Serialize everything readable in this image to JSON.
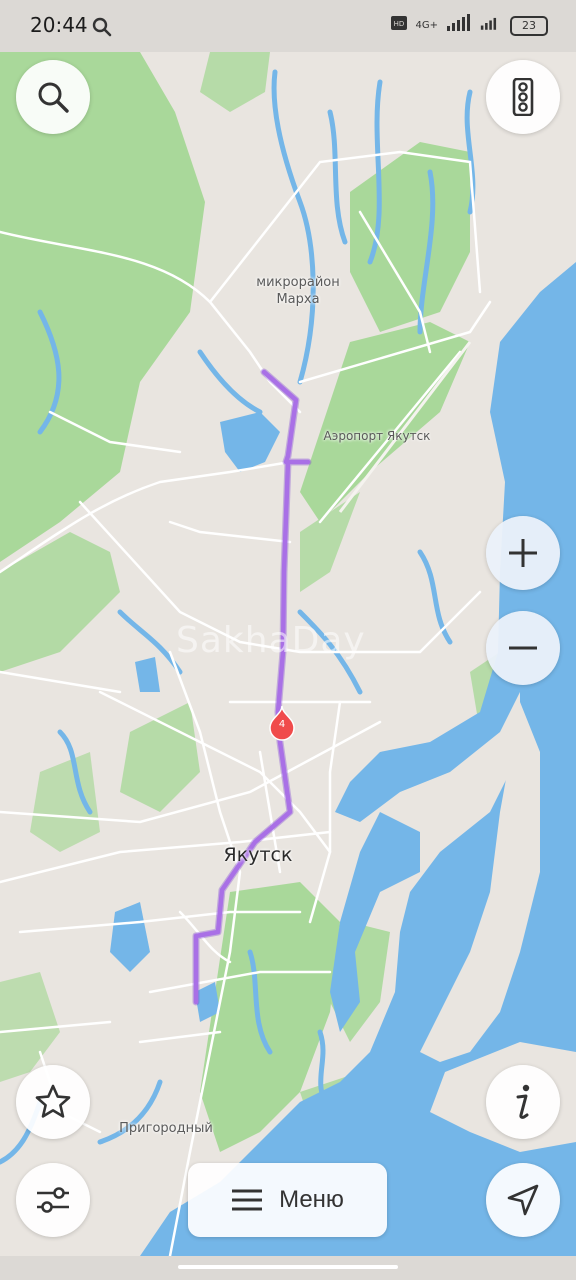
{
  "status_bar": {
    "time": "20:44",
    "network_label": "4G+",
    "battery": "23"
  },
  "map": {
    "labels": {
      "district_line1": "микрорайон",
      "district_line2": "Марха",
      "airport": "Аэропорт Якутск",
      "city": "Якутск",
      "suburb": "Пригородный"
    },
    "watermark": "SakhaDay",
    "route_marker_number": "4",
    "colors": {
      "land": "#e9e5e0",
      "forest": "#a9d89a",
      "water": "#74b6e8",
      "roads": "#ffffff",
      "route": "#a970e6",
      "marker": "#f04b4b"
    }
  },
  "controls": {
    "search_icon": "search-icon",
    "traffic_icon": "traffic-light-icon",
    "zoom_in_icon": "plus-icon",
    "zoom_out_icon": "minus-icon",
    "favorites_icon": "star-icon",
    "info_icon": "info-icon",
    "filters_icon": "sliders-icon",
    "locate_icon": "location-arrow-icon",
    "menu_label": "Меню"
  }
}
